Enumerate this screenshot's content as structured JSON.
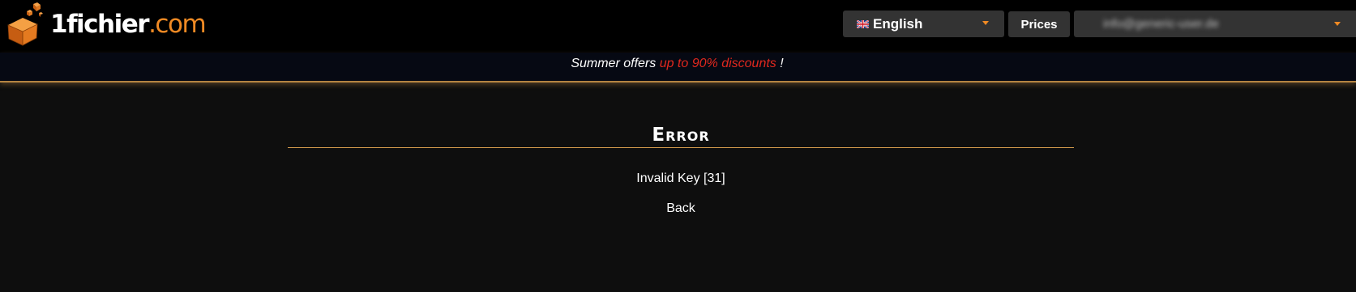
{
  "header": {
    "logo": {
      "text_main": "1fichier",
      "text_tld": ".com",
      "icon": "cube-logo-icon"
    },
    "language": {
      "flag_icon": "uk-flag-icon",
      "selected_label": "English",
      "caret_icon": "chevron-down-icon"
    },
    "prices_label": "Prices",
    "account": {
      "email": "info@generic-user.de",
      "blurred": true,
      "caret_icon": "chevron-down-icon"
    }
  },
  "promo": {
    "text_before": "Summer offers ",
    "highlight": "up to 90% discounts",
    "text_after": " !"
  },
  "main": {
    "title": "Error",
    "message": "Invalid Key [31]",
    "back_label": "Back"
  },
  "colors": {
    "accent_orange": "#f08a24",
    "promo_red": "#e0281e",
    "rule_gold": "#d29a4c",
    "page_bg": "#0e0e0e",
    "header_bg": "#000000",
    "control_bg": "#333333"
  }
}
